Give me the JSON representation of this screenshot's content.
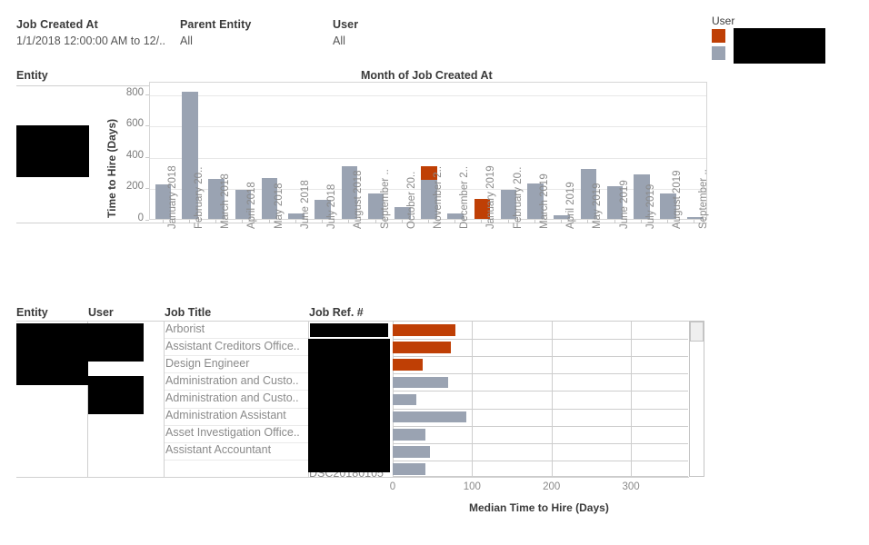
{
  "filters": [
    {
      "name": "job-created-at",
      "label": "Job Created At",
      "value": "1/1/2018 12:00:00 AM to 12/.."
    },
    {
      "name": "parent-entity",
      "label": "Parent Entity",
      "value": "All"
    },
    {
      "name": "user",
      "label": "User",
      "value": "All"
    }
  ],
  "legend": {
    "title": "User",
    "items": [
      {
        "label": "",
        "color": "#bf3f05",
        "redacted": true
      },
      {
        "label": "",
        "color": "#9aa3b2",
        "redacted": true
      }
    ]
  },
  "top_panel": {
    "row_header": "Entity",
    "column_header": "Month of Job Created At",
    "entity_value": "",
    "entity_redacted": true
  },
  "bottom_panel": {
    "columns": [
      "Entity",
      "User",
      "Job Title",
      "Job Ref. #"
    ],
    "entity_redacted": true,
    "user_redacted": true,
    "jobref_redacted": true,
    "jobref_partial": "DSC20180105",
    "rows": [
      {
        "job_title": "Arborist",
        "job_ref": "",
        "user_group": 0
      },
      {
        "job_title": "Assistant Creditors Office..",
        "job_ref": "",
        "user_group": 0
      },
      {
        "job_title": "Design Engineer",
        "job_ref": "",
        "user_group": 0
      },
      {
        "job_title": "Administration and Custo..",
        "job_ref": "",
        "user_group": 1
      },
      {
        "job_title": "Administration and Custo..",
        "job_ref": "",
        "user_group": 1
      },
      {
        "job_title": "Administration Assistant",
        "job_ref": "",
        "user_group": 1
      },
      {
        "job_title": "Asset Investigation Office..",
        "job_ref": "",
        "user_group": 1
      },
      {
        "job_title": "Assistant Accountant",
        "job_ref": "",
        "user_group": 1
      },
      {
        "job_title": "",
        "job_ref": "",
        "user_group": 1
      }
    ]
  },
  "chart_data": [
    {
      "type": "bar",
      "name": "month-of-job-created-at",
      "title": "Month of Job Created At",
      "xlabel": "",
      "ylabel": "Time to Hire (Days)",
      "ylim": [
        0,
        880
      ],
      "yticks": [
        0,
        200,
        400,
        600,
        800
      ],
      "grid": true,
      "stacked": true,
      "legend_position": "right",
      "categories": [
        "January 2018",
        "February 20..",
        "March 2018",
        "April 2018",
        "May 2018",
        "June 2018",
        "July 2018",
        "August 2018",
        "September ..",
        "October 20..",
        "November 2..",
        "December 2..",
        "January 2019",
        "February 20..",
        "March 2019",
        "April 2019",
        "May 2019",
        "June 2019",
        "July 2019",
        "August 2019",
        "September .."
      ],
      "series": [
        {
          "name": "user-gray",
          "color": "#9aa3b2",
          "values": [
            222,
            810,
            252,
            183,
            263,
            34,
            120,
            337,
            165,
            74,
            251,
            34,
            0,
            188,
            228,
            23,
            320,
            211,
            285,
            165,
            12
          ]
        },
        {
          "name": "user-orange",
          "color": "#bf3f05",
          "values": [
            0,
            0,
            0,
            0,
            0,
            0,
            0,
            0,
            0,
            0,
            86,
            0,
            126,
            0,
            0,
            0,
            0,
            0,
            0,
            0,
            0
          ]
        }
      ]
    },
    {
      "type": "bar",
      "name": "median-time-to-hire-by-job",
      "orientation": "horizontal",
      "title": "",
      "xlabel": "Median Time to Hire (Days)",
      "ylabel": "",
      "xlim": [
        0,
        372
      ],
      "xticks": [
        0,
        100,
        200,
        300
      ],
      "grid": true,
      "categories": [
        "Arborist",
        "Assistant Creditors Office..",
        "Design Engineer",
        "Administration and Custo..",
        "Administration and Custo..",
        "Administration Assistant",
        "Asset Investigation Office..",
        "Assistant Accountant",
        ""
      ],
      "values": [
        79,
        73,
        38,
        70,
        30,
        93,
        41,
        47,
        41
      ],
      "colors": [
        "#bf3f05",
        "#bf3f05",
        "#bf3f05",
        "#9aa3b2",
        "#9aa3b2",
        "#9aa3b2",
        "#9aa3b2",
        "#9aa3b2",
        "#9aa3b2"
      ]
    }
  ]
}
